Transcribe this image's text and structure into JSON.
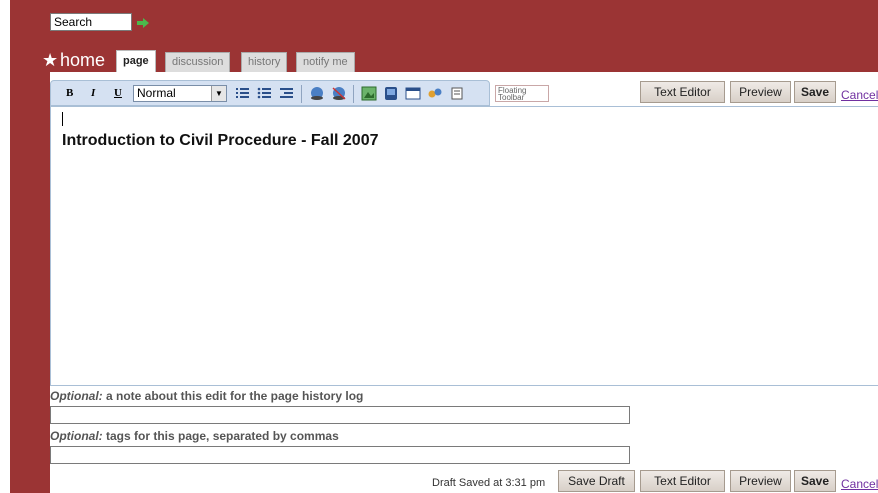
{
  "search": {
    "value": "Search"
  },
  "page": {
    "title": "home"
  },
  "tabs": [
    {
      "label": "page",
      "active": true
    },
    {
      "label": "discussion",
      "active": false
    },
    {
      "label": "history",
      "active": false
    },
    {
      "label": "notify me",
      "active": false
    }
  ],
  "toolbar": {
    "bold": "B",
    "italic": "I",
    "underline": "U",
    "format_select": "Normal",
    "floating_label": "Floating Toolbar",
    "text_editor": "Text Editor",
    "preview": "Preview",
    "save": "Save",
    "cancel": "Cancel"
  },
  "editor": {
    "heading": "Introduction to Civil Procedure - Fall 2007"
  },
  "note": {
    "optional": "Optional:",
    "label": " a note about this edit for the page history log",
    "value": ""
  },
  "tags": {
    "optional": "Optional:",
    "label": " tags for this page, separated by commas",
    "value": ""
  },
  "footer": {
    "draft_status": "Draft Saved at 3:31 pm",
    "save_draft": "Save Draft",
    "text_editor": "Text Editor",
    "preview": "Preview",
    "save": "Save",
    "cancel": "Cancel"
  },
  "colors": {
    "header_bg": "#9b3434",
    "toolbar_bg": "#d5e1f2",
    "link": "#7030a0"
  }
}
